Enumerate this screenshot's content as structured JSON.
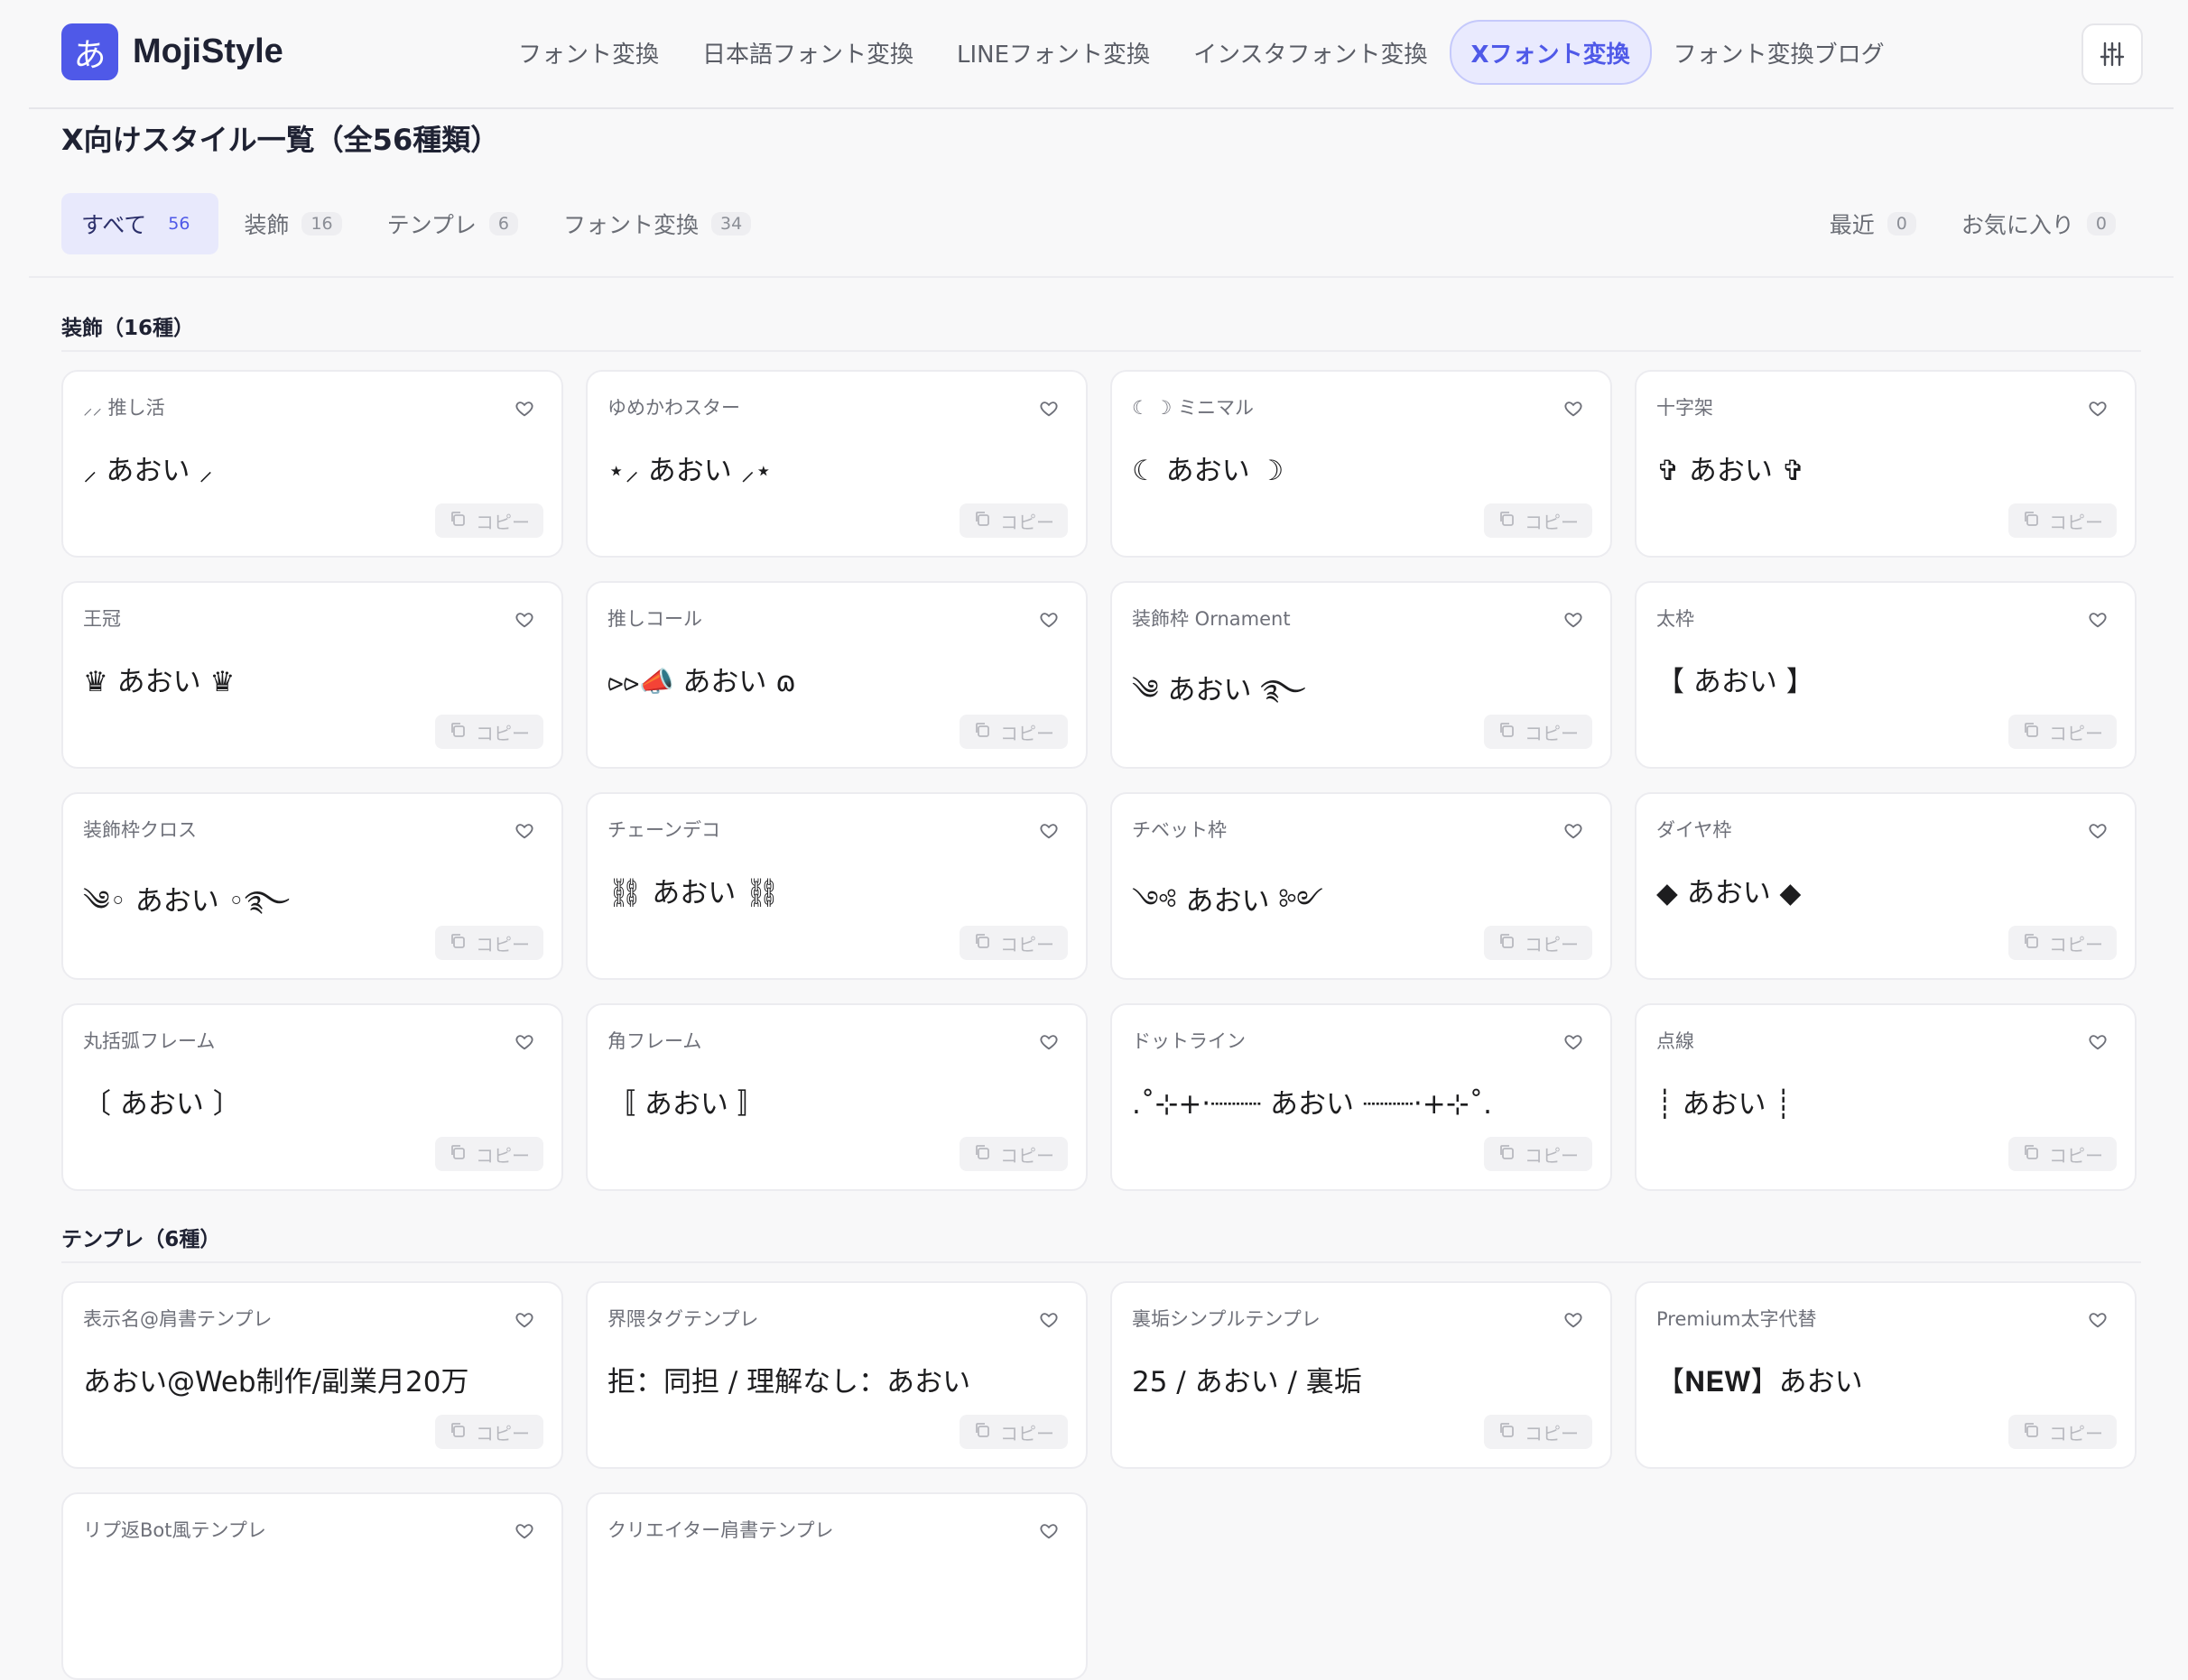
{
  "header": {
    "logo_mark": "あ",
    "logo_text": "MojiStyle",
    "nav": [
      {
        "label": "フォント変換",
        "active": false
      },
      {
        "label": "日本語フォント変換",
        "active": false
      },
      {
        "label": "LINEフォント変換",
        "active": false
      },
      {
        "label": "インスタフォント変換",
        "active": false
      },
      {
        "label": "Xフォント変換",
        "active": true
      },
      {
        "label": "フォント変換ブログ",
        "active": false
      }
    ],
    "settings_icon": "sliders-icon"
  },
  "page_title": "X向けスタイル一覧（全56種類）",
  "filters": {
    "tabs": [
      {
        "label": "すべて",
        "count": "56",
        "active": true
      },
      {
        "label": "装飾",
        "count": "16",
        "active": false
      },
      {
        "label": "テンプレ",
        "count": "6",
        "active": false
      },
      {
        "label": "フォント変換",
        "count": "34",
        "active": false
      }
    ],
    "right": [
      {
        "label": "最近",
        "count": "0"
      },
      {
        "label": "お気に入り",
        "count": "0"
      }
    ]
  },
  "copy_label": "コピー",
  "sections": [
    {
      "title": "装飾（16種）",
      "cards": [
        {
          "name": "⸝⸝ 推し活",
          "preview": "⸝ あおい ⸝"
        },
        {
          "name": "ゆめかわスター",
          "preview": "⋆⸝ あおい ⸝⋆"
        },
        {
          "name": "☾ ☽ ミニマル",
          "preview": "☾ あおい ☽"
        },
        {
          "name": "十字架",
          "preview": "✞ あおい ✞"
        },
        {
          "name": "王冠",
          "preview": "♛ あおい ♛"
        },
        {
          "name": "推しコール",
          "preview": "⪧⪧📣 あおい ɷ"
        },
        {
          "name": "装飾枠 Ornament",
          "preview": "༄ あおい ࿐"
        },
        {
          "name": "太枠",
          "preview": "【 あおい 】"
        },
        {
          "name": "装飾枠クロス",
          "preview": "༄◦ あおい ◦࿐"
        },
        {
          "name": "チェーンデコ",
          "preview": "⛓ あおい ⛓"
        },
        {
          "name": "チベット枠",
          "preview": "༺ あおい ༻"
        },
        {
          "name": "ダイヤ枠",
          "preview": "◆ あおい ◆"
        },
        {
          "name": "丸括弧フレーム",
          "preview": "〔 あおい 〕"
        },
        {
          "name": "角フレーム",
          "preview": "〚 あおい 〛"
        },
        {
          "name": "ドットライン",
          "preview": ".˚⊹+‧┈┈┈ あおい ┈┈┈‧+⊹˚."
        },
        {
          "name": "点線",
          "preview": "┊ あおい ┊"
        }
      ]
    },
    {
      "title": "テンプレ（6種）",
      "cards": [
        {
          "name": "表示名@肩書テンプレ",
          "preview": "あおい@Web制作/副業月20万"
        },
        {
          "name": "界隈タグテンプレ",
          "preview": "拒：同担 / 理解なし：あおい"
        },
        {
          "name": "裏垢シンプルテンプレ",
          "preview": "25 / あおい / 裏垢"
        },
        {
          "name": "Premium太字代替",
          "preview": "【𝐍𝐄𝐖】あおい"
        },
        {
          "name": "リプ返Bot風テンプレ",
          "preview": ""
        },
        {
          "name": "クリエイター肩書テンプレ",
          "preview": ""
        }
      ]
    }
  ]
}
